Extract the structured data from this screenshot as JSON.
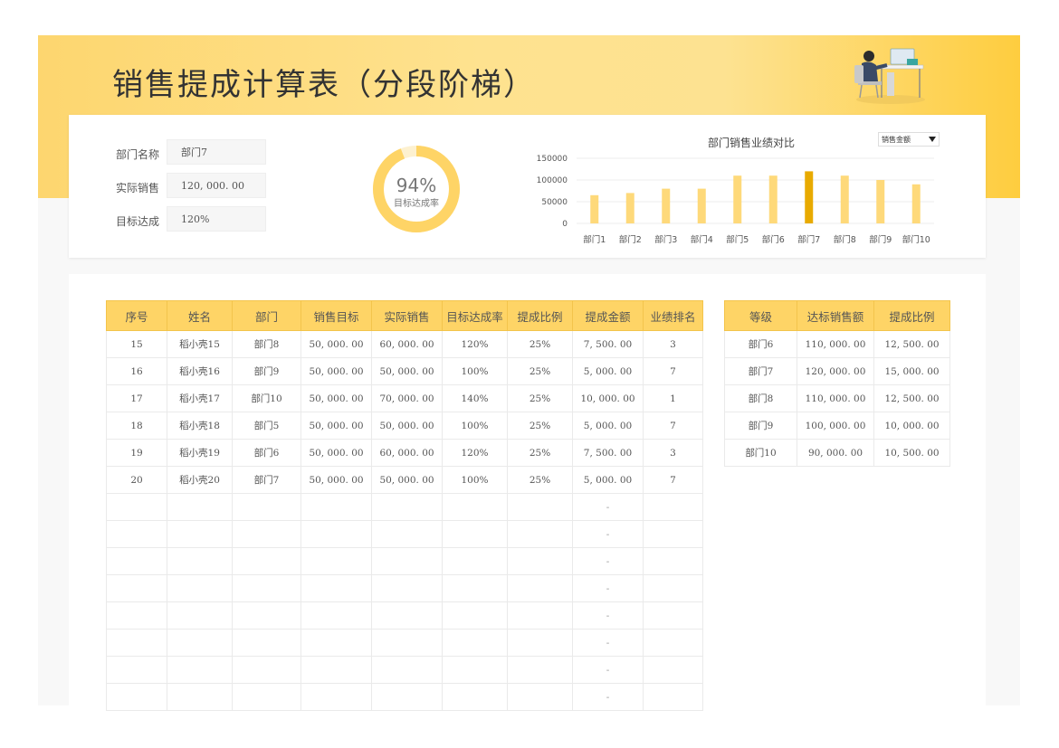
{
  "title": "销售提成计算表（分段阶梯）",
  "fields": [
    {
      "label": "部门名称",
      "value": "部门7"
    },
    {
      "label": "实际销售",
      "value": "120, 000. 00"
    },
    {
      "label": "目标达成",
      "value": "120%"
    }
  ],
  "gauge": {
    "value_text": "94%",
    "label": "目标达成率",
    "fraction": 0.94,
    "color": "#fed466"
  },
  "dropdown": {
    "selected": "销售金额"
  },
  "chart_data": {
    "type": "bar",
    "title": "部门销售业绩对比",
    "categories": [
      "部门1",
      "部门2",
      "部门3",
      "部门4",
      "部门5",
      "部门6",
      "部门7",
      "部门8",
      "部门9",
      "部门10"
    ],
    "values": [
      65000,
      70000,
      80000,
      80000,
      110000,
      110000,
      120000,
      110000,
      100000,
      90000
    ],
    "highlight_index": 6,
    "yticks": [
      "150000",
      "100000",
      "50000",
      "0"
    ],
    "ylim": [
      0,
      150000
    ],
    "bar_color": "#fed97a",
    "highlight_color": "#e8aa00",
    "grid": true
  },
  "main_table": {
    "headers": [
      "序号",
      "姓名",
      "部门",
      "销售目标",
      "实际销售",
      "目标达成率",
      "提成比例",
      "提成金额",
      "业绩排名"
    ],
    "rows": [
      [
        "15",
        "稻小壳15",
        "部门8",
        "50, 000. 00",
        "60, 000. 00",
        "120%",
        "25%",
        "7, 500. 00",
        "3"
      ],
      [
        "16",
        "稻小壳16",
        "部门9",
        "50, 000. 00",
        "50, 000. 00",
        "100%",
        "25%",
        "5, 000. 00",
        "7"
      ],
      [
        "17",
        "稻小壳17",
        "部门10",
        "50, 000. 00",
        "70, 000. 00",
        "140%",
        "25%",
        "10, 000. 00",
        "1"
      ],
      [
        "18",
        "稻小壳18",
        "部门5",
        "50, 000. 00",
        "50, 000. 00",
        "100%",
        "25%",
        "5, 000. 00",
        "7"
      ],
      [
        "19",
        "稻小壳19",
        "部门6",
        "50, 000. 00",
        "60, 000. 00",
        "120%",
        "25%",
        "7, 500. 00",
        "3"
      ],
      [
        "20",
        "稻小壳20",
        "部门7",
        "50, 000. 00",
        "50, 000. 00",
        "100%",
        "25%",
        "5, 000. 00",
        "7"
      ],
      [
        "",
        "",
        "",
        "",
        "",
        "",
        "",
        "-",
        ""
      ],
      [
        "",
        "",
        "",
        "",
        "",
        "",
        "",
        "-",
        ""
      ],
      [
        "",
        "",
        "",
        "",
        "",
        "",
        "",
        "-",
        ""
      ],
      [
        "",
        "",
        "",
        "",
        "",
        "",
        "",
        "-",
        ""
      ],
      [
        "",
        "",
        "",
        "",
        "",
        "",
        "",
        "-",
        ""
      ],
      [
        "",
        "",
        "",
        "",
        "",
        "",
        "",
        "-",
        ""
      ],
      [
        "",
        "",
        "",
        "",
        "",
        "",
        "",
        "-",
        ""
      ],
      [
        "",
        "",
        "",
        "",
        "",
        "",
        "",
        "-",
        ""
      ]
    ]
  },
  "grade_table": {
    "headers": [
      "等级",
      "达标销售额",
      "提成比例"
    ],
    "rows": [
      [
        "部门6",
        "110, 000. 00",
        "12, 500. 00"
      ],
      [
        "部门7",
        "120, 000. 00",
        "15, 000. 00"
      ],
      [
        "部门8",
        "110, 000. 00",
        "12, 500. 00"
      ],
      [
        "部门9",
        "100, 000. 00",
        "10, 000. 00"
      ],
      [
        "部门10",
        "90, 000. 00",
        "10, 500. 00"
      ]
    ]
  }
}
